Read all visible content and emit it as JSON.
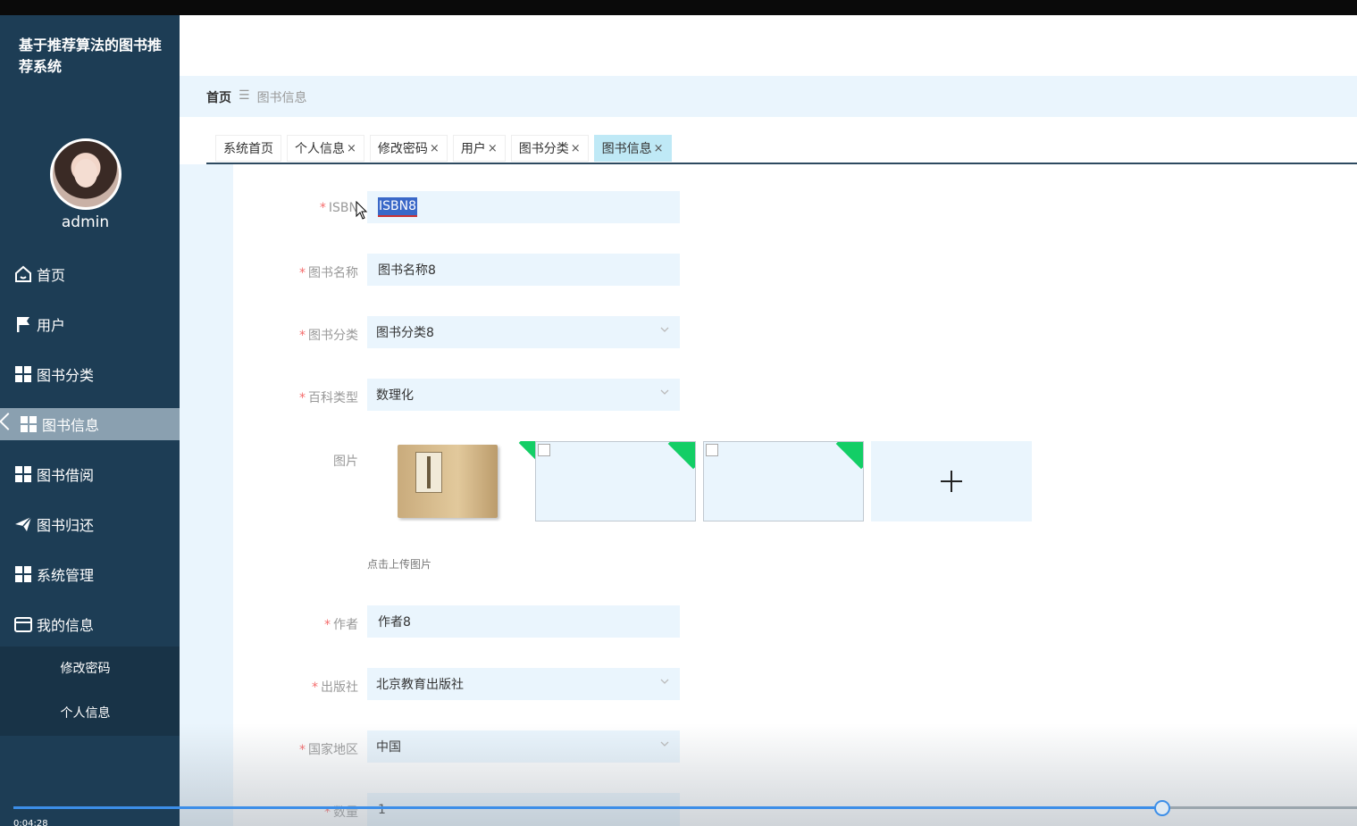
{
  "app": {
    "title": "基于推荐算法的图书推荐系统"
  },
  "user": {
    "name": "admin"
  },
  "sidebar": {
    "items": [
      {
        "label": "首页",
        "icon": "home-icon"
      },
      {
        "label": "用户",
        "icon": "flag-icon"
      },
      {
        "label": "图书分类",
        "icon": "grid-icon"
      },
      {
        "label": "图书信息",
        "icon": "grid-icon",
        "active": true
      },
      {
        "label": "图书借阅",
        "icon": "grid-icon"
      },
      {
        "label": "图书归还",
        "icon": "send-icon"
      },
      {
        "label": "系统管理",
        "icon": "grid-icon"
      },
      {
        "label": "我的信息",
        "icon": "wallet-icon"
      }
    ],
    "submenu": [
      {
        "label": "修改密码"
      },
      {
        "label": "个人信息"
      }
    ]
  },
  "breadcrumb": {
    "home": "首页",
    "separator": "☰",
    "current": "图书信息"
  },
  "tabs": [
    {
      "label": "系统首页",
      "closable": false
    },
    {
      "label": "个人信息",
      "closable": true
    },
    {
      "label": "修改密码",
      "closable": true
    },
    {
      "label": "用户",
      "closable": true
    },
    {
      "label": "图书分类",
      "closable": true
    },
    {
      "label": "图书信息",
      "closable": true,
      "active": true
    }
  ],
  "tab_close": "×",
  "form": {
    "required_mark": "*",
    "isbn": {
      "label": "ISBN",
      "value": "ISBN8"
    },
    "name": {
      "label": "图书名称",
      "value": "图书名称8"
    },
    "category": {
      "label": "图书分类",
      "value": "图书分类8"
    },
    "encyclopedia": {
      "label": "百科类型",
      "value": "数理化"
    },
    "images": {
      "label": "图片",
      "hint": "点击上传图片"
    },
    "author": {
      "label": "作者",
      "value": "作者8"
    },
    "publisher": {
      "label": "出版社",
      "value": "北京教育出版社"
    },
    "region": {
      "label": "国家地区",
      "value": "中国"
    },
    "quantity": {
      "label": "数量",
      "value": "1"
    }
  },
  "video": {
    "time": "0:04:28",
    "progress": 0.855
  },
  "colors": {
    "sidebar_bg": "#1d3d55",
    "active_nav": "#8aa0b0",
    "input_bg": "#eaf5fd",
    "active_tab": "#bfe9f6",
    "required": "#f56c6c",
    "upload_badge": "#13ce66",
    "progress": "#3c8ee8"
  }
}
